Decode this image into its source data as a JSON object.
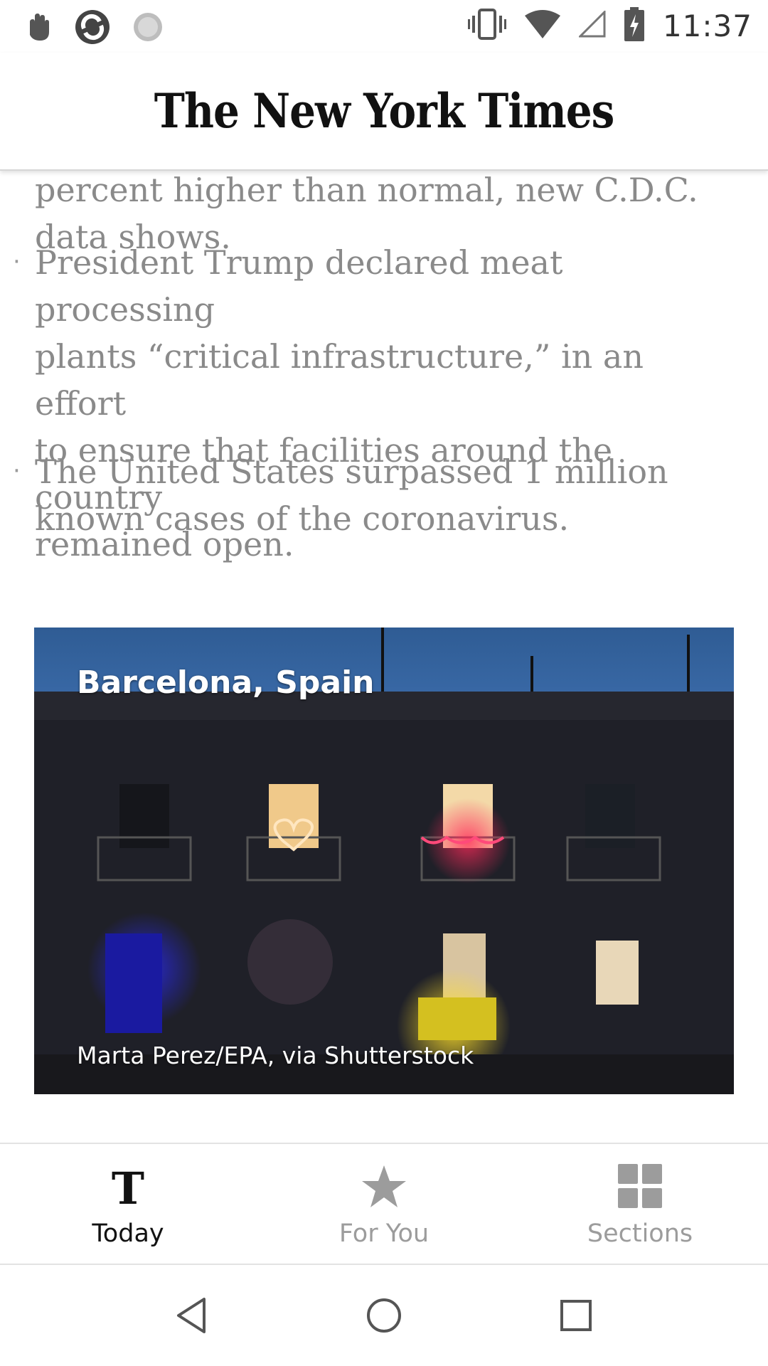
{
  "status_bar": {
    "time": "11:37",
    "left_icons": [
      "hand-icon",
      "refresh-icon",
      "sync-icon"
    ],
    "right_icons": [
      "vibrate-icon",
      "wifi-icon",
      "cellular-icon",
      "battery-icon"
    ]
  },
  "masthead": {
    "logo": "The New York Times"
  },
  "article": {
    "partial_lines": [
      "percent higher than normal, new C.D.C.",
      "data shows."
    ],
    "bullets": [
      {
        "lines": [
          "President Trump declared meat processing",
          "plants “critical infrastructure,” in an effort",
          "to ensure that facilities around the country",
          "remained open."
        ]
      },
      {
        "lines": [
          "The United States surpassed 1 million",
          "known cases of the coronavirus."
        ]
      }
    ]
  },
  "photo": {
    "location": "Barcelona, Spain",
    "credit": "Marta Perez/EPA, via Shutterstock"
  },
  "tab_bar": {
    "tabs": [
      {
        "label": "Today",
        "icon": "nyt-t-icon",
        "active": true
      },
      {
        "label": "For You",
        "icon": "star-icon",
        "active": false
      },
      {
        "label": "Sections",
        "icon": "grid-icon",
        "active": false
      }
    ],
    "active_color": "#121212",
    "inactive_color": "#9c9c9c"
  },
  "nav_bar": {
    "buttons": [
      "back-icon",
      "home-icon",
      "recents-icon"
    ]
  }
}
